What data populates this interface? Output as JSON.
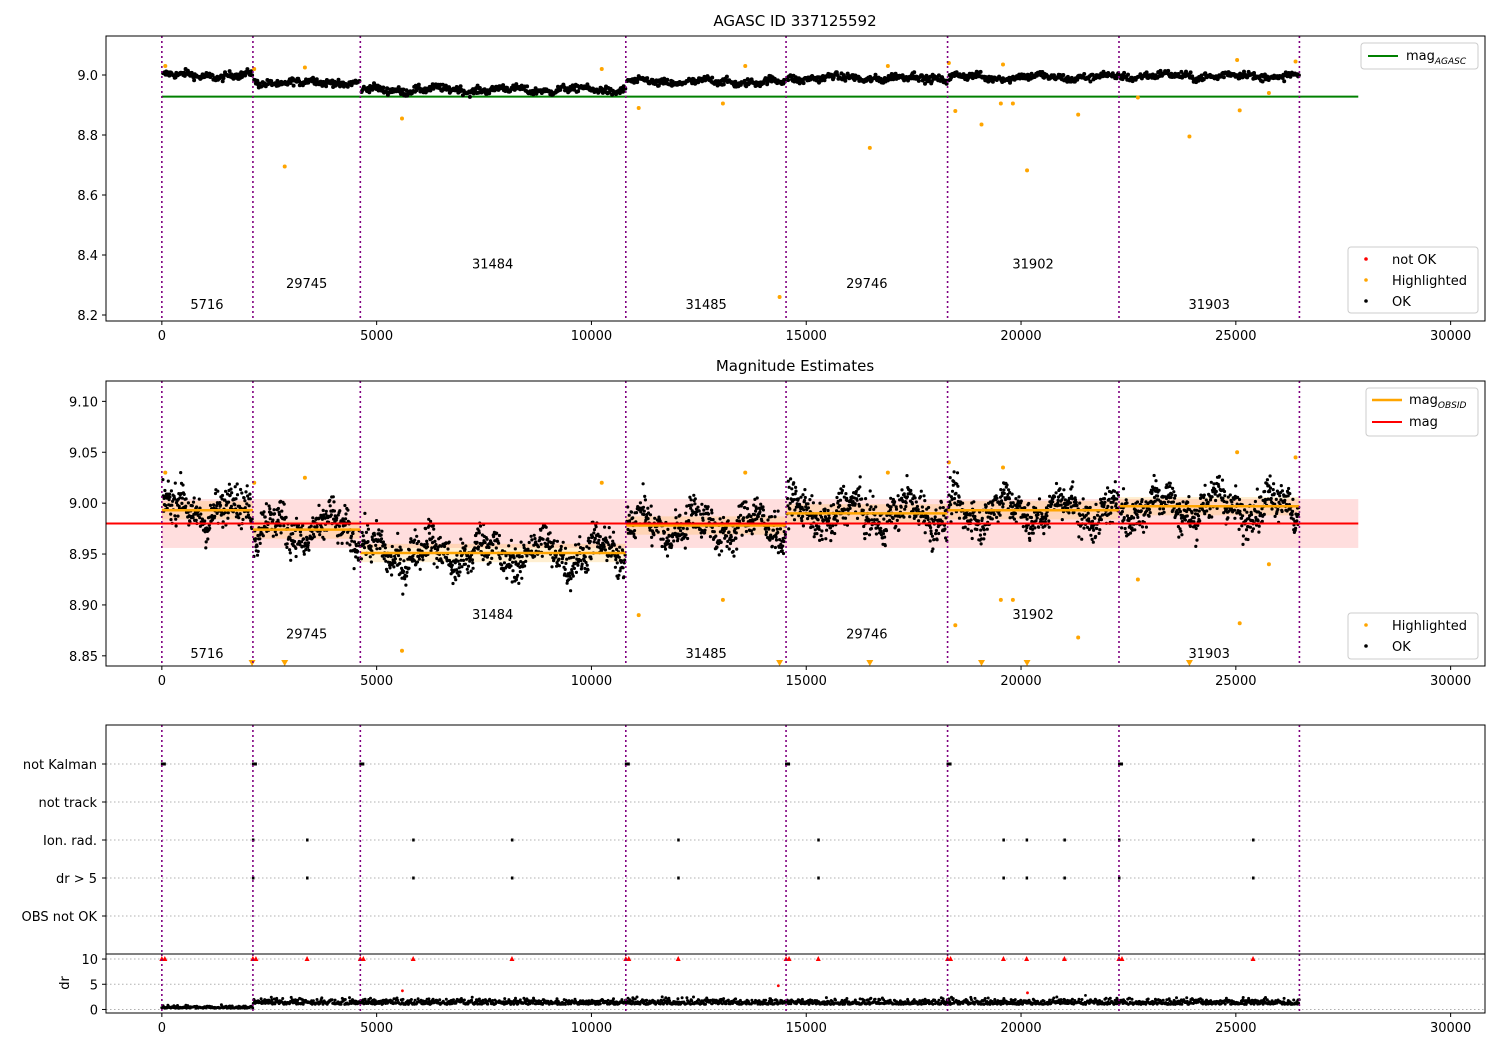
{
  "figure": {
    "x_ticks": [
      0,
      5000,
      10000,
      15000,
      20000,
      25000,
      30000
    ],
    "xlim": [
      -1300,
      30800
    ],
    "segment_boundaries": [
      0,
      2120,
      4620,
      10800,
      14530,
      18290,
      22280,
      26480
    ],
    "obsids": [
      {
        "label": "5716",
        "x": 1050
      },
      {
        "label": "29745",
        "x": 3370
      },
      {
        "label": "31484",
        "x": 7700
      },
      {
        "label": "31485",
        "x": 12670
      },
      {
        "label": "29746",
        "x": 16410
      },
      {
        "label": "31902",
        "x": 20280
      },
      {
        "label": "31903",
        "x": 24380
      }
    ],
    "colors": {
      "ok": "#000000",
      "highlighted": "#ffa500",
      "not_ok": "#ff0000",
      "agasc_line": "#008000",
      "mag_line": "#ff0000",
      "obsid_line": "#ffa500",
      "boundary": "#800080"
    }
  },
  "chart_data": [
    {
      "type": "scatter",
      "title": "AGASC ID 337125592",
      "ylim": [
        8.18,
        9.13
      ],
      "y_ticks": [
        "8.2",
        "8.4",
        "8.6",
        "8.8",
        "9.0"
      ],
      "agasc_mag": 8.928,
      "agasc_mag_x_range": [
        0,
        27850
      ],
      "legend_line": {
        "base": "mag",
        "sub": "AGASC"
      },
      "legend_points": [
        "not OK",
        "Highlighted",
        "OK"
      ],
      "series": [
        {
          "name": "OK",
          "segments": [
            {
              "x": [
                0,
                2120
              ],
              "level": 8.998
            },
            {
              "x": [
                2120,
                4620
              ],
              "level": 8.975
            },
            {
              "x": [
                4620,
                10800
              ],
              "level": 8.951
            },
            {
              "x": [
                10800,
                14530
              ],
              "level": 8.977
            },
            {
              "x": [
                14530,
                18290
              ],
              "level": 8.99
            },
            {
              "x": [
                18290,
                22280
              ],
              "level": 8.993
            },
            {
              "x": [
                22280,
                26480
              ],
              "level": 8.997
            }
          ]
        },
        {
          "name": "Highlighted",
          "points": [
            [
              2860,
              8.695
            ],
            [
              5590,
              8.855
            ],
            [
              11100,
              8.89
            ],
            [
              13060,
              8.905
            ],
            [
              14380,
              8.26
            ],
            [
              16480,
              8.757
            ],
            [
              18470,
              8.88
            ],
            [
              19080,
              8.835
            ],
            [
              19530,
              8.905
            ],
            [
              19810,
              8.905
            ],
            [
              20140,
              8.682
            ],
            [
              21330,
              8.868
            ],
            [
              22720,
              8.925
            ],
            [
              23920,
              8.795
            ],
            [
              25090,
              8.882
            ],
            [
              25770,
              8.94
            ]
          ]
        }
      ]
    },
    {
      "type": "scatter",
      "title": "Magnitude Estimates",
      "ylim": [
        8.84,
        9.12
      ],
      "y_ticks": [
        "8.85",
        "8.90",
        "8.95",
        "9.00",
        "9.05",
        "9.10"
      ],
      "mag": 8.98,
      "mag_band": [
        8.956,
        9.004
      ],
      "obsid_mag": [
        8.993,
        8.974,
        8.951,
        8.978,
        8.99,
        8.993,
        8.997
      ],
      "legend_lines": [
        {
          "base": "mag",
          "sub": "OBSID"
        },
        {
          "base": "mag",
          "sub": ""
        }
      ],
      "legend_points": [
        "Highlighted",
        "OK"
      ]
    },
    {
      "type": "scatter",
      "categories": [
        "not Kalman",
        "not track",
        "Ion. rad.",
        "dr > 5",
        "OBS not OK"
      ],
      "flag_x": {
        "not Kalman": [
          0,
          2120,
          4620,
          10800,
          14530,
          18290,
          22280
        ],
        "not track": [],
        "Ion. rad.": [
          2120,
          3380,
          5850,
          8150,
          12020,
          15280,
          19590,
          20130,
          21010,
          22280,
          25400
        ],
        "dr > 5": [
          2120,
          3380,
          5850,
          8150,
          12020,
          15280,
          19590,
          20130,
          21010,
          22280,
          25400
        ],
        "OBS not OK": []
      }
    },
    {
      "type": "scatter",
      "ylabel": "dr",
      "ylim": [
        -0.7,
        11
      ],
      "y_ticks": [
        "0",
        "5",
        "10"
      ],
      "capped_at": 10,
      "outliers": [
        [
          5600,
          3.7
        ],
        [
          14350,
          4.7
        ],
        [
          20150,
          3.3
        ],
        [
          21500,
          2.8
        ]
      ]
    }
  ]
}
